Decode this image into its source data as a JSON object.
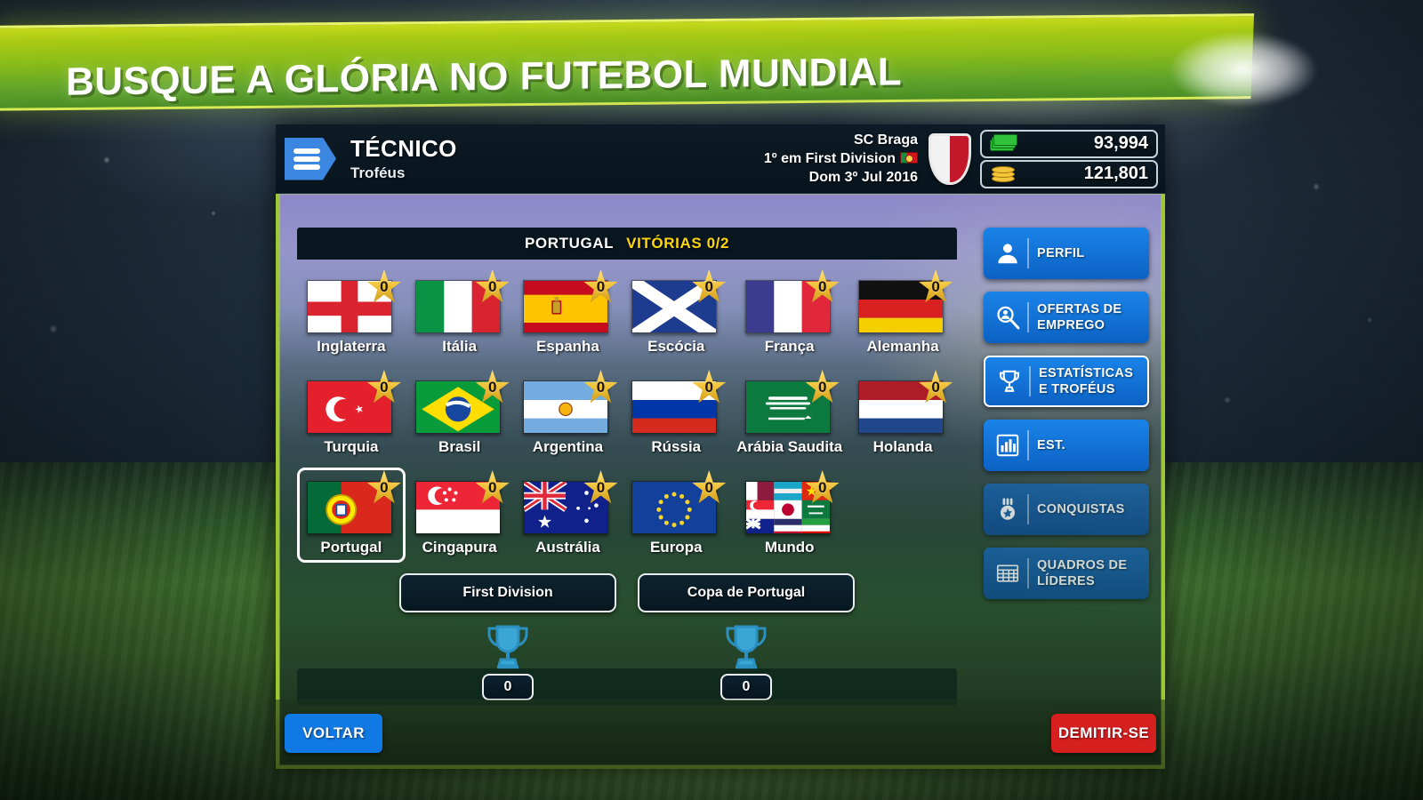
{
  "banner": {
    "headline": "BUSQUE A GLÓRIA NO FUTEBOL MUNDIAL"
  },
  "header": {
    "menu_icon": "hamburger-icon",
    "title": "TÉCNICO",
    "subtitle": "Troféus",
    "club_name": "SC Braga",
    "club_position": "1º em First Division",
    "club_flag_icon": "portugal-flag-icon",
    "date": "Dom 3º Jul 2016",
    "crest_icon": "club-crest-icon",
    "cash_icon": "cash-icon",
    "cash_value": "93,994",
    "coins_icon": "coins-icon",
    "coins_value": "121,801"
  },
  "trophy_panel": {
    "country": "PORTUGAL",
    "wins_label": "VITÓRIAS 0/2",
    "nations": [
      {
        "name": "Inglaterra",
        "stars": "0",
        "flag": "england",
        "selected": false
      },
      {
        "name": "Itália",
        "stars": "0",
        "flag": "italy",
        "selected": false
      },
      {
        "name": "Espanha",
        "stars": "0",
        "flag": "spain",
        "selected": false
      },
      {
        "name": "Escócia",
        "stars": "0",
        "flag": "scotland",
        "selected": false
      },
      {
        "name": "França",
        "stars": "0",
        "flag": "france",
        "selected": false
      },
      {
        "name": "Alemanha",
        "stars": "0",
        "flag": "germany",
        "selected": false
      },
      {
        "name": "Turquia",
        "stars": "0",
        "flag": "turkey",
        "selected": false
      },
      {
        "name": "Brasil",
        "stars": "0",
        "flag": "brazil",
        "selected": false
      },
      {
        "name": "Argentina",
        "stars": "0",
        "flag": "argentina",
        "selected": false
      },
      {
        "name": "Rússia",
        "stars": "0",
        "flag": "russia",
        "selected": false
      },
      {
        "name": "Arábia Saudita",
        "stars": "0",
        "flag": "saudi-arabia",
        "selected": false
      },
      {
        "name": "Holanda",
        "stars": "0",
        "flag": "netherlands",
        "selected": false
      },
      {
        "name": "Portugal",
        "stars": "0",
        "flag": "portugal",
        "selected": true
      },
      {
        "name": "Cingapura",
        "stars": "0",
        "flag": "singapore",
        "selected": false
      },
      {
        "name": "Austrália",
        "stars": "0",
        "flag": "australia",
        "selected": false
      },
      {
        "name": "Europa",
        "stars": "0",
        "flag": "europe",
        "selected": false
      },
      {
        "name": "Mundo",
        "stars": "0",
        "flag": "world",
        "selected": false
      }
    ],
    "competitions": [
      {
        "label": "First Division",
        "trophy_icon": "trophy-icon",
        "count": "0"
      },
      {
        "label": "Copa de Portugal",
        "trophy_icon": "trophy-icon",
        "count": "0"
      }
    ]
  },
  "side_menu": {
    "items": [
      {
        "label": "PERFIL",
        "icon": "person-icon",
        "state": "normal"
      },
      {
        "label": "OFERTAS DE EMPREGO",
        "icon": "job-search-icon",
        "state": "normal"
      },
      {
        "label": "ESTATÍSTICAS E TROFÉUS",
        "icon": "trophy-icon",
        "state": "active"
      },
      {
        "label": "EST.",
        "icon": "bar-chart-icon",
        "state": "normal"
      },
      {
        "label": "CONQUISTAS",
        "icon": "medal-icon",
        "state": "dim"
      },
      {
        "label": "QUADROS DE LÍDERES",
        "icon": "leaderboard-icon",
        "state": "dim"
      }
    ]
  },
  "footer": {
    "back_label": "VOLTAR",
    "resign_label": "DEMITIR-SE"
  },
  "colors": {
    "banner_green": "#8dbe18",
    "accent_blue": "#1179e4",
    "danger_red": "#d61f1f",
    "wins_yellow": "#ffd60a",
    "frame_green": "#9dc733",
    "panel_dark": "#081620"
  }
}
